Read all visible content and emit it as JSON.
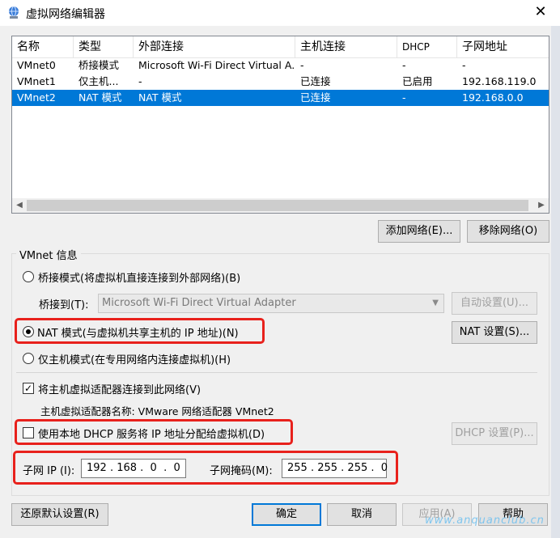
{
  "window": {
    "title": "虚拟网络编辑器"
  },
  "list": {
    "columns": [
      "名称",
      "类型",
      "外部连接",
      "主机连接",
      "DHCP",
      "子网地址"
    ],
    "rows": [
      {
        "name": "VMnet0",
        "type": "桥接模式",
        "external": "Microsoft Wi-Fi Direct Virtual A...",
        "host": "-",
        "dhcp": "-",
        "subnet": "-"
      },
      {
        "name": "VMnet1",
        "type": "仅主机...",
        "external": "-",
        "host": "已连接",
        "dhcp": "已启用",
        "subnet": "192.168.119.0"
      },
      {
        "name": "VMnet2",
        "type": "NAT 模式",
        "external": "NAT 模式",
        "host": "已连接",
        "dhcp": "-",
        "subnet": "192.168.0.0"
      }
    ],
    "selected_row": 2
  },
  "buttons": {
    "add_network": "添加网络(E)...",
    "remove_network": "移除网络(O)",
    "auto_settings": "自动设置(U)...",
    "nat_settings": "NAT 设置(S)...",
    "dhcp_settings": "DHCP 设置(P)...",
    "restore_defaults": "还原默认设置(R)",
    "ok": "确定",
    "cancel": "取消",
    "apply": "应用(A)",
    "help": "帮助"
  },
  "vmnet_info": {
    "group_title": "VMnet 信息",
    "bridged_label": "桥接模式(将虚拟机直接连接到外部网络)(B)",
    "bridged_to_label": "桥接到(T):",
    "bridged_to_value": "Microsoft Wi-Fi Direct Virtual Adapter",
    "nat_label": "NAT 模式(与虚拟机共享主机的 IP 地址)(N)",
    "hostonly_label": "仅主机模式(在专用网络内连接虚拟机)(H)",
    "selected_mode": "nat",
    "connect_adapter_label": "将主机虚拟适配器连接到此网络(V)",
    "connect_adapter_checked": true,
    "adapter_name_label": "主机虚拟适配器名称: VMware 网络适配器 VMnet2",
    "use_dhcp_label": "使用本地 DHCP 服务将 IP 地址分配给虚拟机(D)",
    "use_dhcp_checked": false,
    "subnet_ip_label": "子网 IP (I):",
    "subnet_ip_value": "192 . 168 .  0  .  0",
    "subnet_mask_label": "子网掩码(M):",
    "subnet_mask_value": "255 . 255 . 255 .  0"
  },
  "watermark": "www.anquanclub.cn",
  "colors": {
    "selection": "#0078d7",
    "highlight_box": "#e8211c"
  }
}
